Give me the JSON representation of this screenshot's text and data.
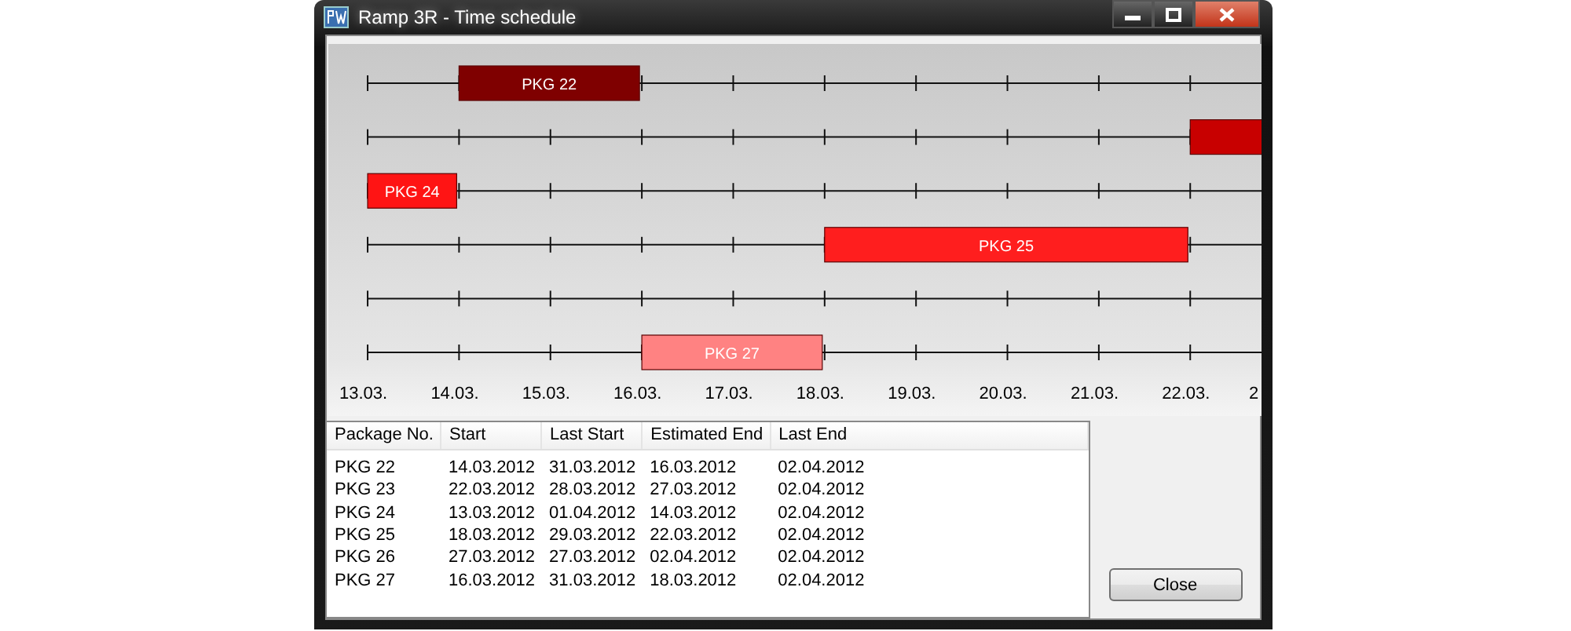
{
  "window": {
    "title": "Ramp 3R - Time schedule"
  },
  "schedule": {
    "dates": [
      "13.03.",
      "14.03.",
      "15.03.",
      "16.03.",
      "17.03.",
      "18.03.",
      "19.03.",
      "20.03.",
      "21.03.",
      "22.03.",
      "2"
    ],
    "bars": [
      {
        "label": "PKG 22",
        "color": "#7f0000"
      },
      {
        "color": "#c80000"
      },
      {
        "label": "PKG 24",
        "color": "#ff1414"
      },
      {
        "label": "PKG 25",
        "color": "#ff1e1e"
      },
      {
        "label": "PKG 27",
        "color": "#ff8282"
      }
    ]
  },
  "table": {
    "columns": [
      "Package No.",
      "Start",
      "Last Start",
      "Estimated End",
      "Last End"
    ],
    "rows": [
      [
        "PKG 22",
        "14.03.2012",
        "31.03.2012",
        "16.03.2012",
        "02.04.2012"
      ],
      [
        "PKG 23",
        "22.03.2012",
        "28.03.2012",
        "27.03.2012",
        "02.04.2012"
      ],
      [
        "PKG 24",
        "13.03.2012",
        "01.04.2012",
        "14.03.2012",
        "02.04.2012"
      ],
      [
        "PKG 25",
        "18.03.2012",
        "29.03.2012",
        "22.03.2012",
        "02.04.2012"
      ],
      [
        "PKG 26",
        "27.03.2012",
        "27.03.2012",
        "02.04.2012",
        "02.04.2012"
      ],
      [
        "PKG 27",
        "16.03.2012",
        "31.03.2012",
        "18.03.2012",
        "02.04.2012"
      ]
    ]
  },
  "buttons": [
    "Close"
  ]
}
